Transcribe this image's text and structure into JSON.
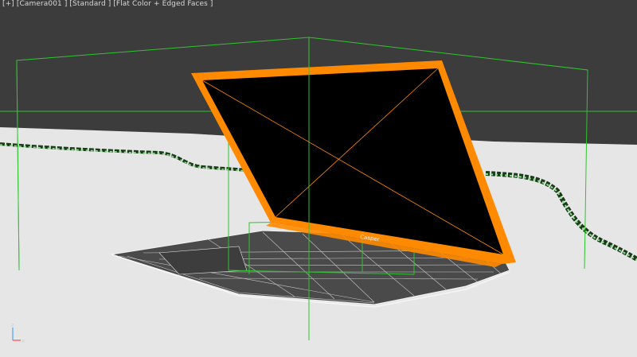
{
  "viewport": {
    "menus": [
      {
        "label": "[+]"
      },
      {
        "label": "[Camera001 ]"
      },
      {
        "label": "[Standard ]"
      },
      {
        "label": "[Flat Color + Edged Faces ]"
      }
    ],
    "colors": {
      "background": "#3c3c3c",
      "floor": "#e6e6e6",
      "bounding_box": "#2fc42f",
      "selection_wire": "#ff8a00",
      "screen": "#000000"
    },
    "axis_labels": {
      "z": "z",
      "x": "x"
    },
    "logo": "Casper"
  }
}
